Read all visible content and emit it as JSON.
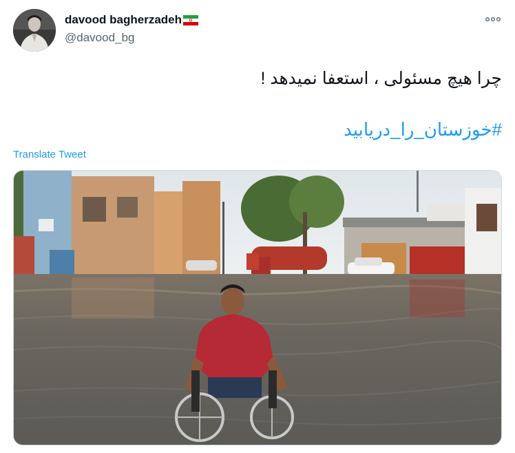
{
  "user": {
    "name": "davood bagherzadeh",
    "handle": "@davood_bg",
    "flag_icon": "iran-flag-icon",
    "avatar_icon": "profile-photo-avatar"
  },
  "more_icon": "more-dots-icon",
  "tweet": {
    "text": "چرا هیچ مسئولی ، استعفا نمیدهد !",
    "hashtag": "#خوزستان_را_دریابید",
    "translate_label": "Translate Tweet"
  },
  "media": {
    "description_icon": "flooded-street-photo"
  },
  "colors": {
    "link": "#1d9bf0",
    "text": "#0f1419",
    "secondary": "#536471"
  }
}
